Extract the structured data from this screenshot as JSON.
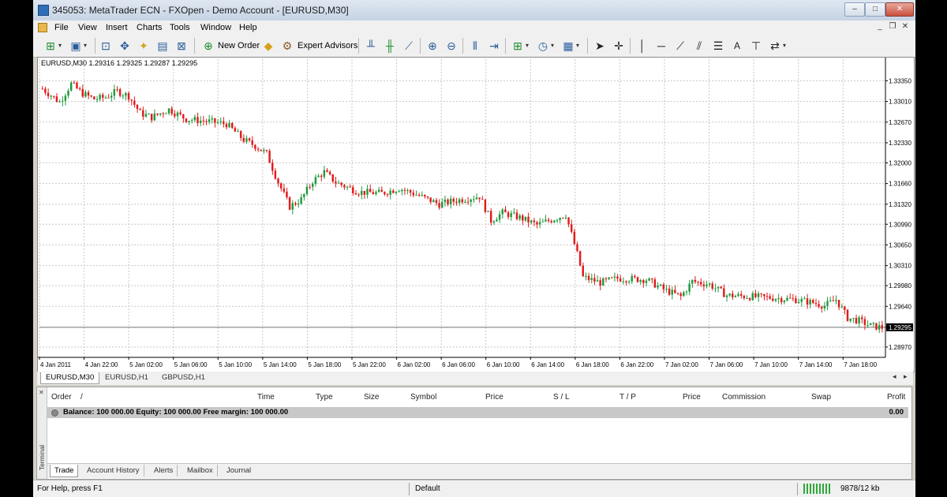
{
  "window": {
    "title": "345053: MetaTrader ECN - FXOpen - Demo Account - [EURUSD,M30]",
    "controls": {
      "minimize": "–",
      "maximize": "□",
      "close": "✕"
    }
  },
  "menu": [
    "File",
    "View",
    "Insert",
    "Charts",
    "Tools",
    "Window",
    "Help"
  ],
  "toolbar": {
    "new_order_label": "New Order",
    "expert_advisors_label": "Expert Advisors",
    "text_tool_label": "A"
  },
  "chart": {
    "info_line": "EURUSD,M30  1.29316 1.29325 1.29287 1.29295",
    "current_price_label": "1.29295",
    "colors": {
      "bull": "#1f9a3c",
      "bear": "#e01b1b",
      "grid": "#c8c8c8",
      "price_line": "#707070"
    }
  },
  "chart_data": {
    "type": "candlestick",
    "symbol": "EURUSD",
    "timeframe": "M30",
    "ylim": [
      1.288,
      1.3355
    ],
    "y_ticks": [
      "1.33350",
      "1.33010",
      "1.32670",
      "1.32330",
      "1.32000",
      "1.31660",
      "1.31320",
      "1.30990",
      "1.30650",
      "1.30310",
      "1.29980",
      "1.29640",
      "1.29295",
      "1.28970"
    ],
    "x_ticks": [
      "4 Jan 2011",
      "4 Jan 22:00",
      "5 Jan 02:00",
      "5 Jan 06:00",
      "5 Jan 10:00",
      "5 Jan 14:00",
      "5 Jan 18:00",
      "5 Jan 22:00",
      "6 Jan 02:00",
      "6 Jan 06:00",
      "6 Jan 10:00",
      "6 Jan 14:00",
      "6 Jan 18:00",
      "6 Jan 22:00",
      "7 Jan 02:00",
      "7 Jan 06:00",
      "7 Jan 10:00",
      "7 Jan 14:00",
      "7 Jan 18:00"
    ],
    "last_close": 1.29295
  },
  "chart_tabs": [
    "EURUSD,M30",
    "EURUSD,H1",
    "GBPUSD,H1"
  ],
  "terminal": {
    "side_label": "Terminal",
    "columns": [
      "Order",
      "/",
      "Time",
      "Type",
      "Size",
      "Symbol",
      "Price",
      "S / L",
      "T / P",
      "Price",
      "Commission",
      "Swap",
      "Profit"
    ],
    "balance_line": "Balance: 100 000.00  Equity: 100 000.00  Free margin: 100 000.00",
    "balance_profit": "0.00",
    "tabs": [
      "Trade",
      "Account History",
      "Alerts",
      "Mailbox",
      "Journal"
    ]
  },
  "status": {
    "help": "For Help, press F1",
    "profile": "Default",
    "connection": "9878/12 kb"
  }
}
